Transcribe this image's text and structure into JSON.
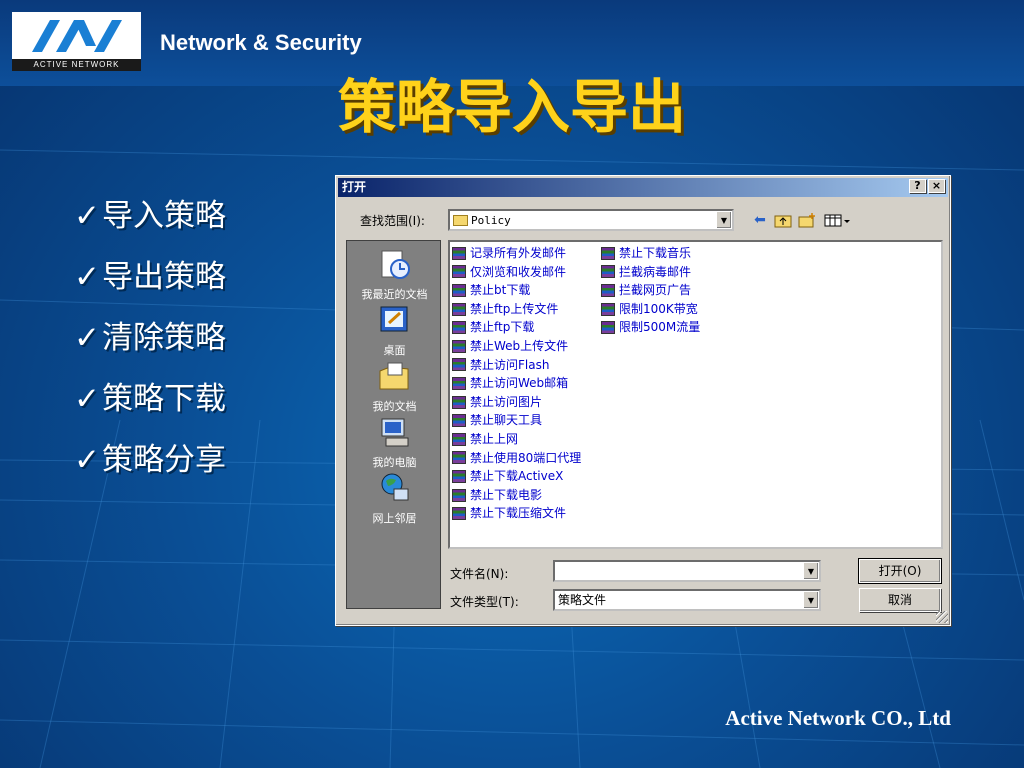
{
  "header": {
    "logo_text": "ACTIVE NETWORK",
    "brand": "Network & Security",
    "title": "策略导入导出"
  },
  "bullets": [
    {
      "label": "导入策略"
    },
    {
      "label": "导出策略"
    },
    {
      "label": "清除策略"
    },
    {
      "label": "策略下载"
    },
    {
      "label": "策略分享"
    }
  ],
  "check_glyph": "✓",
  "dialog": {
    "title": "打开",
    "help_btn": "?",
    "close_btn": "×",
    "lookin_label": "查找范围(I):",
    "lookin_value": "Policy",
    "places": [
      {
        "label": "我最近的文档",
        "icon": "recent-documents-icon"
      },
      {
        "label": "桌面",
        "icon": "desktop-icon"
      },
      {
        "label": "我的文档",
        "icon": "my-documents-icon"
      },
      {
        "label": "我的电脑",
        "icon": "my-computer-icon"
      },
      {
        "label": "网上邻居",
        "icon": "network-places-icon"
      }
    ],
    "files_col1": [
      "记录所有外发邮件",
      "仅浏览和收发邮件",
      "禁止bt下载",
      "禁止ftp上传文件",
      "禁止ftp下载",
      "禁止Web上传文件",
      "禁止访问Flash",
      "禁止访问Web邮箱",
      "禁止访问图片",
      "禁止聊天工具",
      "禁止上网",
      "禁止使用80端口代理",
      "禁止下载ActiveX",
      "禁止下载电影",
      "禁止下载压缩文件"
    ],
    "files_col2": [
      "禁止下载音乐",
      "拦截病毒邮件",
      "拦截网页广告",
      "限制100K带宽",
      "限制500M流量"
    ],
    "filename_label": "文件名(N):",
    "filename_value": "",
    "filetype_label": "文件类型(T):",
    "filetype_value": "策略文件",
    "open_btn": "打开(O)",
    "cancel_btn": "取消"
  },
  "footer": "Active Network CO., Ltd"
}
